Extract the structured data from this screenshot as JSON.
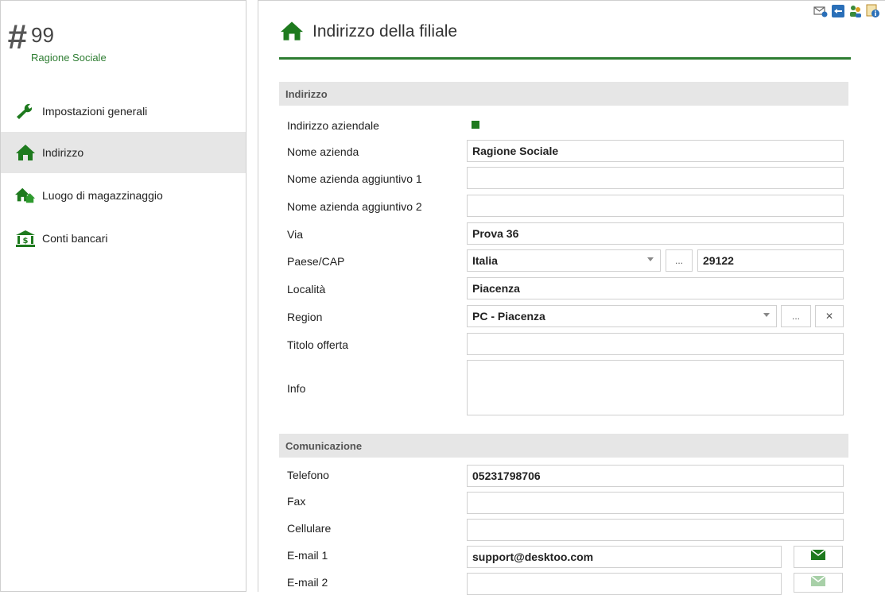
{
  "sidebar": {
    "hash": "#",
    "record_number": "99",
    "record_name": "Ragione Sociale",
    "items": [
      {
        "label": "Impostazioni generali",
        "icon": "wrench-icon"
      },
      {
        "label": "Indirizzo",
        "icon": "house-icon",
        "active": true
      },
      {
        "label": "Luogo di magazzinaggio",
        "icon": "warehouse-icon"
      },
      {
        "label": "Conti bancari",
        "icon": "bank-icon"
      }
    ]
  },
  "header": {
    "title": "Indirizzo della filiale",
    "toolbar_icons": [
      "mail-settings-icon",
      "refresh-icon",
      "users-icon",
      "info-icon"
    ]
  },
  "sections": {
    "address": "Indirizzo",
    "communication": "Comunicazione"
  },
  "form": {
    "company_address_label": "Indirizzo aziendale",
    "company_address_checked": true,
    "company_name_label": "Nome azienda",
    "company_name_value": "Ragione Sociale",
    "company_name_extra1_label": "Nome azienda aggiuntivo 1",
    "company_name_extra1_value": "",
    "company_name_extra2_label": "Nome azienda aggiuntivo 2",
    "company_name_extra2_value": "",
    "street_label": "Via",
    "street_value": "Prova 36",
    "country_zip_label": "Paese/CAP",
    "country_value": "Italia",
    "zip_value": "29122",
    "city_label": "Località",
    "city_value": "Piacenza",
    "region_label": "Region",
    "region_value": "PC - Piacenza",
    "offer_title_label": "Titolo offerta",
    "offer_title_value": "",
    "info_label": "Info",
    "info_value": "",
    "ellipsis": "...",
    "clear": "✕"
  },
  "communication": {
    "phone_label": "Telefono",
    "phone_value": "05231798706",
    "fax_label": "Fax",
    "fax_value": "",
    "mobile_label": "Cellulare",
    "mobile_value": "",
    "email1_label": "E-mail 1",
    "email1_value": "support@desktoo.com",
    "email2_label": "E-mail 2",
    "email2_value": ""
  },
  "colors": {
    "accent": "#2e7d32",
    "section_bg": "#e6e6e6",
    "active_item_bg": "#e6e6e6"
  }
}
